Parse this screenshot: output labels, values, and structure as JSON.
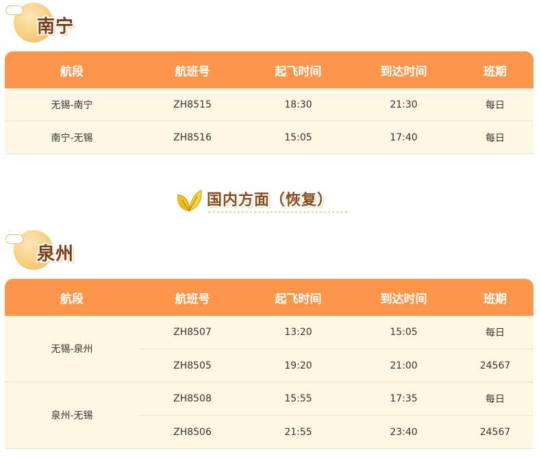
{
  "columns": [
    "航段",
    "航班号",
    "起飞时间",
    "到达时间",
    "班期"
  ],
  "section1": {
    "city": "南宁",
    "rows": [
      {
        "route": "无锡-南宁",
        "flight": "ZH8515",
        "dep": "18:30",
        "arr": "21:30",
        "days": "每日"
      },
      {
        "route": "南宁-无锡",
        "flight": "ZH8516",
        "dep": "15:05",
        "arr": "17:40",
        "days": "每日"
      }
    ]
  },
  "banner": {
    "title": "国内方面（恢复）",
    "icon": "leaf-icon"
  },
  "section2": {
    "city": "泉州",
    "groups": [
      {
        "route": "无锡-泉州",
        "flights": [
          {
            "flight": "ZH8507",
            "dep": "13:20",
            "arr": "15:05",
            "days": "每日"
          },
          {
            "flight": "ZH8505",
            "dep": "19:20",
            "arr": "21:00",
            "days": "24567"
          }
        ]
      },
      {
        "route": "泉州-无锡",
        "flights": [
          {
            "flight": "ZH8508",
            "dep": "15:55",
            "arr": "17:35",
            "days": "每日"
          },
          {
            "flight": "ZH8506",
            "dep": "21:55",
            "arr": "23:40",
            "days": "24567"
          }
        ]
      }
    ]
  },
  "colors": {
    "header": "#fc9549",
    "row": "#fff6e4",
    "city_text": "#7a3a12"
  }
}
